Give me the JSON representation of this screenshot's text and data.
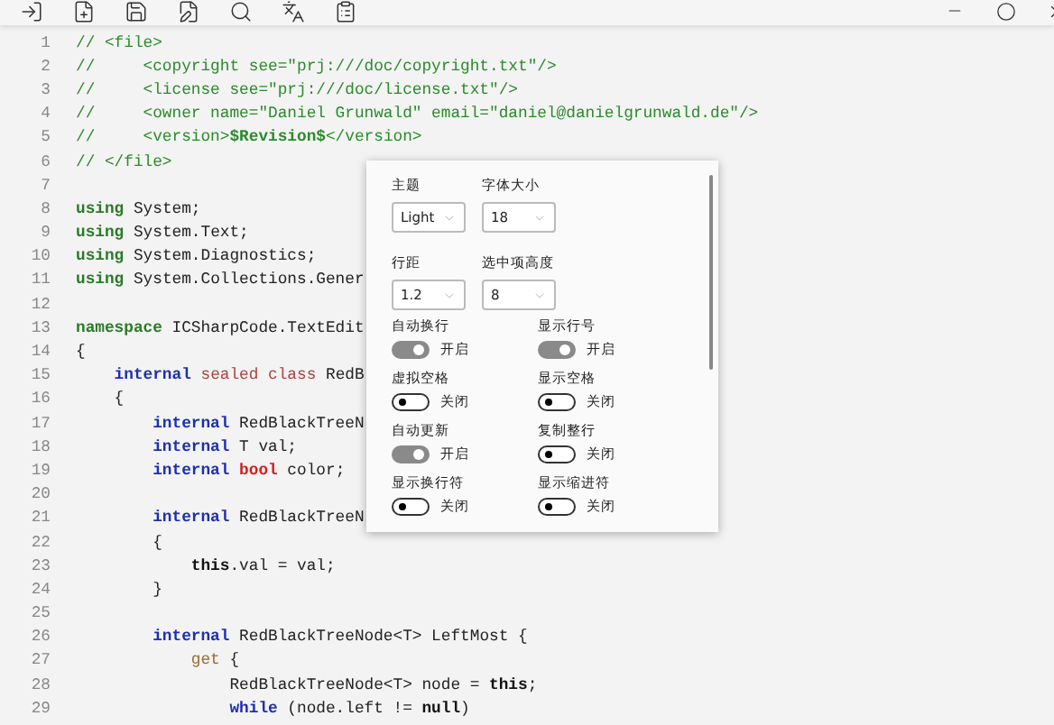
{
  "toolbar": {
    "tools": [
      {
        "kind": "import"
      },
      {
        "kind": "new"
      },
      {
        "kind": "save"
      },
      {
        "kind": "edit"
      },
      {
        "kind": "search"
      },
      {
        "kind": "translate"
      },
      {
        "kind": "clipboard"
      }
    ]
  },
  "window_controls": [
    {
      "kind": "minimize"
    },
    {
      "kind": "maximize"
    },
    {
      "kind": "close"
    }
  ],
  "editor": {
    "lines": [
      {
        "number": "1",
        "tokens": [
          {
            "kind": "comment",
            "text": "// <file>"
          }
        ]
      },
      {
        "number": "2",
        "tokens": [
          {
            "kind": "comment",
            "text": "//     <copyright see=\"prj:///doc/copyright.txt\"/>"
          }
        ]
      },
      {
        "number": "3",
        "tokens": [
          {
            "kind": "comment",
            "text": "//     <license see=\"prj:///doc/license.txt\"/>"
          }
        ]
      },
      {
        "number": "4",
        "tokens": [
          {
            "kind": "comment",
            "text": "//     <owner name=\"Daniel Grunwald\" email=\"daniel@danielgrunwald.de\"/>"
          }
        ]
      },
      {
        "number": "5",
        "tokens": [
          {
            "kind": "comment",
            "text": "//     <version>"
          },
          {
            "kind": "comment_bold",
            "text": "$Revision$"
          },
          {
            "kind": "comment",
            "text": "</version>"
          }
        ]
      },
      {
        "number": "6",
        "tokens": [
          {
            "kind": "comment",
            "text": "// </file>"
          }
        ]
      },
      {
        "number": "7"
      },
      {
        "number": "8",
        "tokens": [
          {
            "kind": "directive",
            "text": "using"
          },
          {
            "kind": "plain",
            "text": " System;"
          }
        ]
      },
      {
        "number": "9",
        "tokens": [
          {
            "kind": "directive",
            "text": "using"
          },
          {
            "kind": "plain",
            "text": " System.Text;"
          }
        ]
      },
      {
        "number": "10",
        "tokens": [
          {
            "kind": "directive",
            "text": "using"
          },
          {
            "kind": "plain",
            "text": " System.Diagnostics;"
          }
        ]
      },
      {
        "number": "11",
        "tokens": [
          {
            "kind": "directive",
            "text": "using"
          },
          {
            "kind": "plain",
            "text": " System.Collections.Gener"
          }
        ]
      },
      {
        "number": "12"
      },
      {
        "number": "13",
        "tokens": [
          {
            "kind": "directive",
            "text": "namespace"
          },
          {
            "kind": "plain",
            "text": " ICSharpCode.TextEdit"
          }
        ]
      },
      {
        "number": "14",
        "tokens": [
          {
            "kind": "plain",
            "text": "{"
          }
        ]
      },
      {
        "number": "15",
        "tokens": [
          {
            "kind": "keyword",
            "text": "    internal"
          },
          {
            "kind": "modifier",
            "text": " sealed class"
          },
          {
            "kind": "plain",
            "text": " RedB"
          }
        ]
      },
      {
        "number": "16",
        "tokens": [
          {
            "kind": "plain",
            "text": "    {"
          }
        ]
      },
      {
        "number": "17",
        "tokens": [
          {
            "kind": "keyword",
            "text": "        internal"
          },
          {
            "kind": "plain",
            "text": " RedBlackTreeN"
          }
        ]
      },
      {
        "number": "18",
        "tokens": [
          {
            "kind": "keyword",
            "text": "        internal"
          },
          {
            "kind": "plain",
            "text": " T val;"
          }
        ]
      },
      {
        "number": "19",
        "tokens": [
          {
            "kind": "keyword",
            "text": "        internal"
          },
          {
            "kind": "type",
            "text": " bool"
          },
          {
            "kind": "plain",
            "text": " color;"
          }
        ]
      },
      {
        "number": "20"
      },
      {
        "number": "21",
        "tokens": [
          {
            "kind": "keyword",
            "text": "        internal"
          },
          {
            "kind": "plain",
            "text": " RedBlackTreeN"
          }
        ]
      },
      {
        "number": "22",
        "tokens": [
          {
            "kind": "plain",
            "text": "        {"
          }
        ]
      },
      {
        "number": "23",
        "tokens": [
          {
            "kind": "bold",
            "text": "            this"
          },
          {
            "kind": "plain",
            "text": ".val = val;"
          }
        ]
      },
      {
        "number": "24",
        "tokens": [
          {
            "kind": "plain",
            "text": "        }"
          }
        ]
      },
      {
        "number": "25"
      },
      {
        "number": "26",
        "tokens": [
          {
            "kind": "keyword",
            "text": "        internal"
          },
          {
            "kind": "plain",
            "text": " RedBlackTreeNode<T> LeftMost {"
          }
        ]
      },
      {
        "number": "27",
        "tokens": [
          {
            "kind": "accessor",
            "text": "            get"
          },
          {
            "kind": "plain",
            "text": " {"
          }
        ]
      },
      {
        "number": "28",
        "tokens": [
          {
            "kind": "plain",
            "text": "                RedBlackTreeNode<T> node = "
          },
          {
            "kind": "bold",
            "text": "this"
          },
          {
            "kind": "plain",
            "text": ";"
          }
        ]
      },
      {
        "number": "29",
        "tokens": [
          {
            "kind": "keyword",
            "text": "                while"
          },
          {
            "kind": "plain",
            "text": " (node.left != "
          },
          {
            "kind": "bold",
            "text": "null"
          },
          {
            "kind": "plain",
            "text": ")"
          }
        ]
      }
    ]
  },
  "settings_popup": {
    "selects": [
      {
        "label": "主题",
        "value": "Light"
      },
      {
        "label": "字体大小",
        "value": "18"
      },
      {
        "label": "行距",
        "value": "1.2"
      },
      {
        "label": "选中项高度",
        "value": "8"
      }
    ],
    "toggles": [
      {
        "label": "自动换行",
        "on": true,
        "state": "开启"
      },
      {
        "label": "显示行号",
        "on": true,
        "state": "开启"
      },
      {
        "label": "虚拟空格",
        "on": false,
        "state": "关闭"
      },
      {
        "label": "显示空格",
        "on": false,
        "state": "关闭"
      },
      {
        "label": "自动更新",
        "on": true,
        "state": "开启"
      },
      {
        "label": "复制整行",
        "on": false,
        "state": "关闭"
      },
      {
        "label": "显示换行符",
        "on": false,
        "state": "关闭"
      },
      {
        "label": "显示缩进符",
        "on": false,
        "state": "关闭"
      }
    ]
  }
}
